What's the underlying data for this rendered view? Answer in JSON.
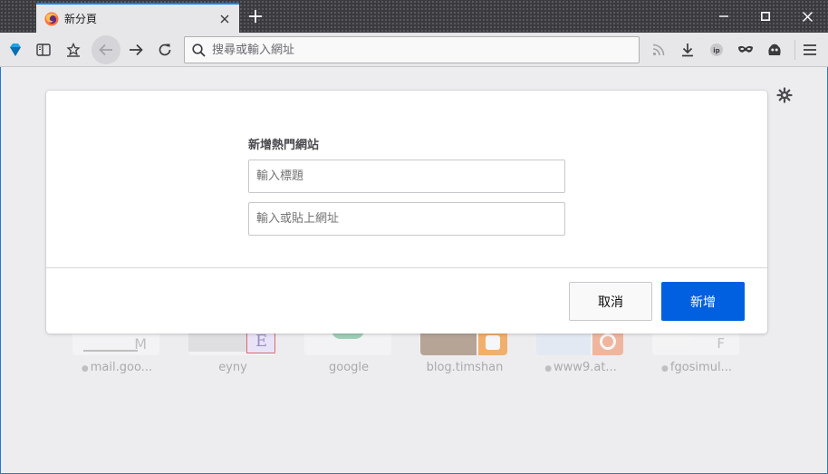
{
  "browser": {
    "tab": {
      "title": "新分頁"
    },
    "window_controls": [
      "minimize",
      "maximize",
      "close"
    ],
    "url_bar": {
      "placeholder": "搜尋或輸入網址"
    },
    "colors": {
      "accent": "#0a84ff",
      "primary_button": "#0060df",
      "frame": "#1f7ad6"
    }
  },
  "top_sites": [
    {
      "label": "mail.goo...",
      "pinned": true
    },
    {
      "label": "eyny",
      "pinned": false
    },
    {
      "label": "google",
      "pinned": false
    },
    {
      "label": "blog.timshan",
      "pinned": false
    },
    {
      "label": "www9.at...",
      "pinned": true
    },
    {
      "label": "fgosimul...",
      "pinned": true
    }
  ],
  "dialog": {
    "title": "新增熱門網站",
    "title_field": {
      "placeholder": "輸入標題"
    },
    "url_field": {
      "placeholder": "輸入或貼上網址"
    },
    "cancel_label": "取消",
    "add_label": "新增"
  }
}
